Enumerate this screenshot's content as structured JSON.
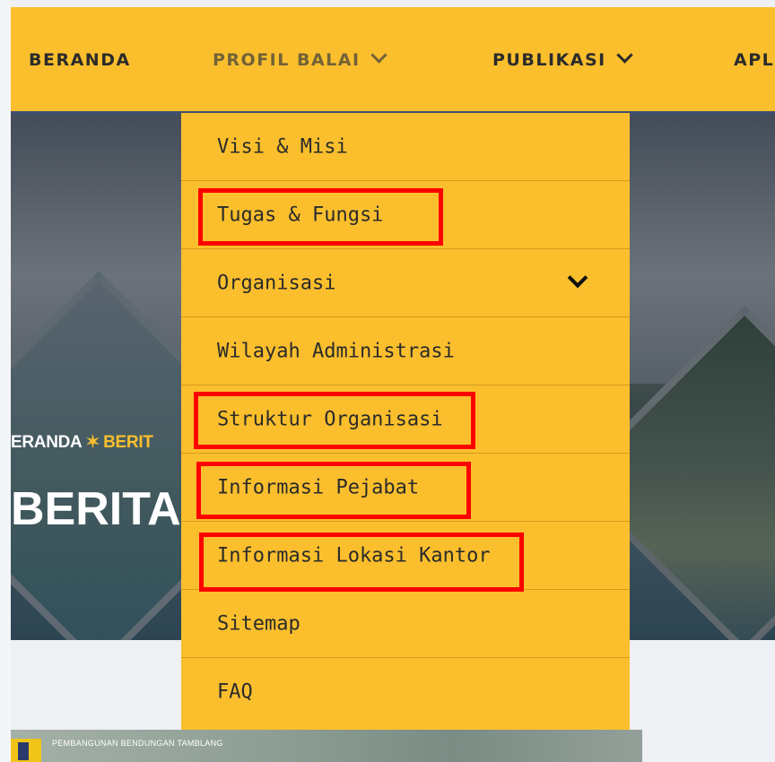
{
  "navbar": {
    "items": [
      {
        "label": "BERANDA"
      },
      {
        "label": "PROFIL BALAI"
      },
      {
        "label": "PUBLIKASI"
      },
      {
        "label": "APL"
      }
    ]
  },
  "hero": {
    "breadcrumb": {
      "home": "ERANDA",
      "separator": "✶",
      "current": "BERIT"
    },
    "title": "BERITA"
  },
  "dropdown": {
    "items": [
      {
        "label": "Visi & Misi"
      },
      {
        "label": "Tugas & Fungsi"
      },
      {
        "label": "Organisasi"
      },
      {
        "label": "Wilayah Administrasi"
      },
      {
        "label": "Struktur Organisasi"
      },
      {
        "label": "Informasi Pejabat"
      },
      {
        "label": "Informasi Lokasi Kantor"
      },
      {
        "label": "Sitemap"
      },
      {
        "label": "FAQ"
      }
    ]
  },
  "banner": {
    "text": "PEMBANGUNAN BENDUNGAN TAMBLANG"
  },
  "colors": {
    "accent": "#fbbf2d",
    "nav_border": "#3f4f6e",
    "highlight": "#ff0000"
  }
}
